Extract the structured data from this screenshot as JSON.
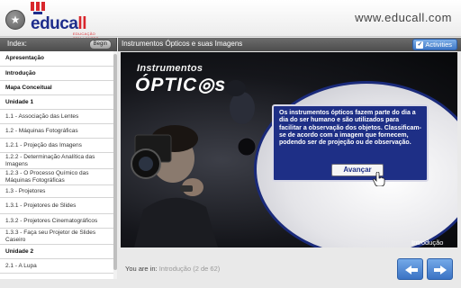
{
  "header": {
    "logo_text_main": "educa",
    "logo_text_accent": "ll",
    "logo_tagline": "EDUCAÇÃO SEM LIMITES",
    "site_url": "www.educall.com",
    "star_glyph": "★"
  },
  "sidebar": {
    "index_label": "Index:",
    "begin_label": "Begin",
    "items": [
      {
        "label": "Apresentação",
        "bold": true
      },
      {
        "label": "Introdução",
        "bold": true
      },
      {
        "label": "Mapa Conceitual",
        "bold": true
      },
      {
        "label": "Unidade 1",
        "bold": true
      },
      {
        "label": "1.1 - Associação das Lentes",
        "bold": false
      },
      {
        "label": "1.2 - Máquinas Fotográficas",
        "bold": false
      },
      {
        "label": "1.2.1 - Projeção das Imagens",
        "bold": false
      },
      {
        "label": "1.2.2 - Determinação Analítica das Imagens",
        "bold": false
      },
      {
        "label": "1.2.3 - O Processo Químico das Máquinas Fotográficas",
        "bold": false
      },
      {
        "label": "1.3 - Projetores",
        "bold": false
      },
      {
        "label": "1.3.1 - Projetores de Slides",
        "bold": false
      },
      {
        "label": "1.3.2 - Projetores Cinematográficos",
        "bold": false
      },
      {
        "label": "1.3.3 - Faça seu Projetor de Slides Caseiro",
        "bold": false
      },
      {
        "label": "Unidade 2",
        "bold": true
      },
      {
        "label": "2.1 - A Lupa",
        "bold": false
      }
    ]
  },
  "content": {
    "title": "Instrumentos Ópticos e suas Imagens",
    "activities_label": "Activities",
    "stage_title_line1": "Instrumentos",
    "stage_title_line2": "ÓPTIC◎s",
    "info_text": "Os instrumentos ópticos fazem parte do dia a dia do ser humano e são utilizados para facilitar a observação dos objetos. Classificam-se de acordo com a imagem que fornecem, podendo ser de projeção ou de observação.",
    "advance_label": "Avançar",
    "section_label": "Introdução"
  },
  "footer": {
    "you_are_in_label": "You are in:",
    "location_value": "Introdução (2 de 62)"
  },
  "colors": {
    "brand_blue": "#1e2d8c",
    "brand_red": "#d9262c",
    "nav_blue": "#3b73c4",
    "infobox_blue": "#1e2f86"
  }
}
